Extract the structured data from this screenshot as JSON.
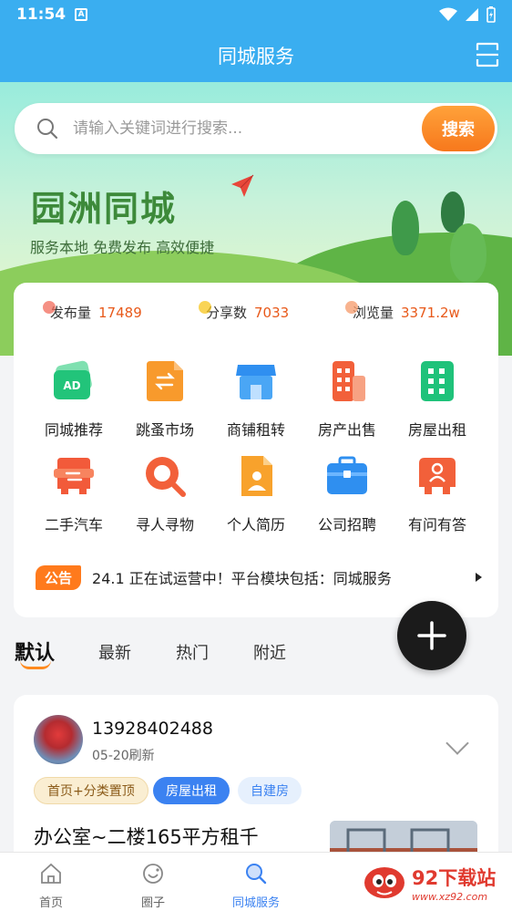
{
  "status_bar": {
    "time": "11:54",
    "badge": "A"
  },
  "header": {
    "title": "同城服务"
  },
  "search": {
    "placeholder": "请输入关键词进行搜索...",
    "button_label": "搜索"
  },
  "banner": {
    "title": "园洲同城",
    "slogan": "服务本地 免费发布 高效便捷"
  },
  "stats": [
    {
      "label": "发布量",
      "value": "17489",
      "dot_color": "#f26b5b"
    },
    {
      "label": "分享数",
      "value": "7033",
      "dot_color": "#f7c51e"
    },
    {
      "label": "浏览量",
      "value": "3371.2w",
      "dot_color": "#f59a6a"
    }
  ],
  "categories": [
    {
      "label": "同城推荐",
      "icon": "ad-icon",
      "color": "#22c47a"
    },
    {
      "label": "跳蚤市场",
      "icon": "exchange-icon",
      "color": "#f89a2c"
    },
    {
      "label": "商铺租转",
      "icon": "shop-icon",
      "color": "#2f8ff0"
    },
    {
      "label": "房产出售",
      "icon": "building-icon",
      "color": "#f2603a"
    },
    {
      "label": "房屋出租",
      "icon": "building-icon",
      "color": "#1fc27a"
    },
    {
      "label": "二手汽车",
      "icon": "car-icon",
      "color": "#f25a3a"
    },
    {
      "label": "寻人寻物",
      "icon": "search-person-icon",
      "color": "#f2603a"
    },
    {
      "label": "个人简历",
      "icon": "resume-icon",
      "color": "#f8a22c"
    },
    {
      "label": "公司招聘",
      "icon": "briefcase-icon",
      "color": "#2f8ff0"
    },
    {
      "label": "有问有答",
      "icon": "qa-icon",
      "color": "#f2603a"
    }
  ],
  "notice": {
    "tag": "公告",
    "text": "24.1 正在试运营中！平台模块包括：同城服务"
  },
  "tabs": [
    "默认",
    "最新",
    "热门",
    "附近"
  ],
  "post": {
    "phone": "13928402488",
    "time": "05-20刷新",
    "chips": [
      "首页+分类置顶",
      "房屋出租",
      "自建房"
    ],
    "headline": "办公室~二楼165平方租千"
  },
  "bottom_nav": [
    {
      "label": "首页",
      "icon": "home-icon"
    },
    {
      "label": "圈子",
      "icon": "circle-icon"
    },
    {
      "label": "同城服务",
      "icon": "search-icon"
    }
  ],
  "watermark": {
    "title": "92下载站",
    "url": "www.xz92.com"
  },
  "colors": {
    "primary": "#3aaef0",
    "accent": "#ff7a1c",
    "blue": "#3b82f1"
  }
}
